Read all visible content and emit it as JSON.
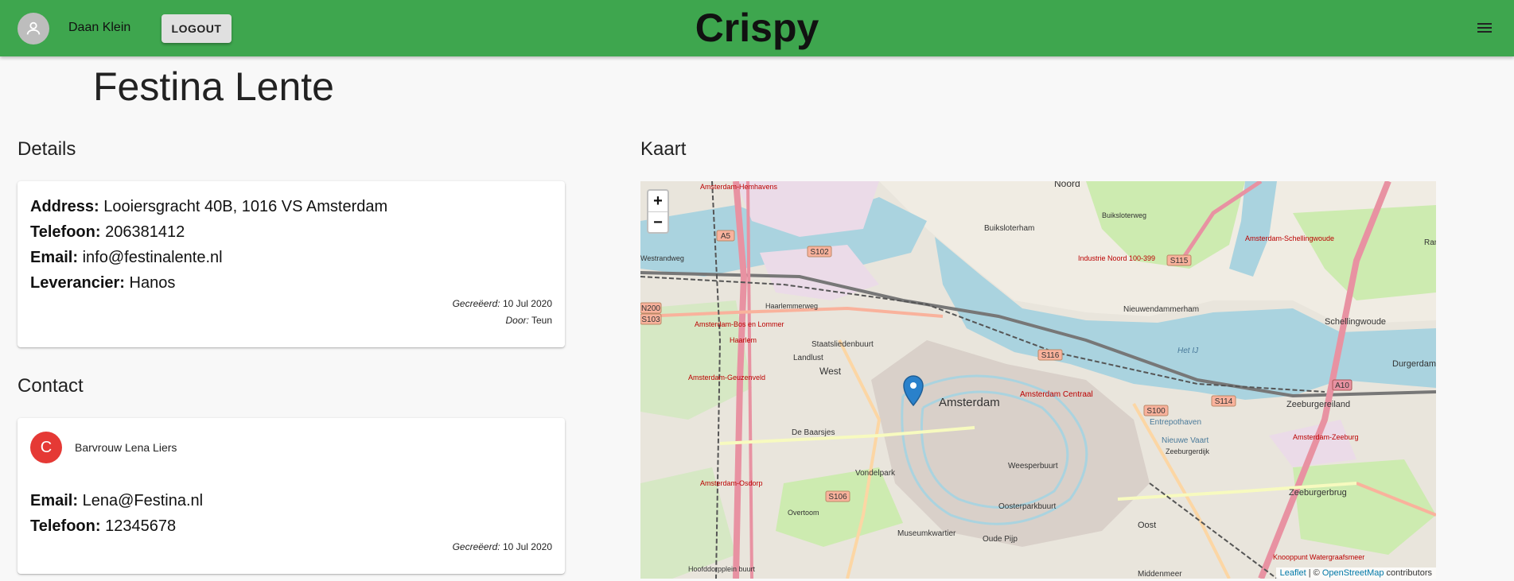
{
  "header": {
    "user_name": "Daan Klein",
    "logout_label": "LOGOUT",
    "brand": "Crispy",
    "icons": [
      "account-icon",
      "menu-icon"
    ]
  },
  "page": {
    "title": "Festina Lente"
  },
  "details": {
    "section_title": "Details",
    "fields": [
      {
        "label": "Address:",
        "value": "Looiersgracht 40B, 1016 VS Amsterdam"
      },
      {
        "label": "Telefoon:",
        "value": "206381412"
      },
      {
        "label": "Email:",
        "value": "info@festinalente.nl"
      },
      {
        "label": "Leverancier:",
        "value": "Hanos"
      }
    ],
    "created_label": "Gecreëerd:",
    "created_value": "10 Jul 2020",
    "by_label": "Door:",
    "by_value": "Teun"
  },
  "contact": {
    "section_title": "Contact",
    "avatar_letter": "C",
    "name": "Barvrouw Lena Liers",
    "fields": [
      {
        "label": "Email:",
        "value": "Lena@Festina.nl"
      },
      {
        "label": "Telefoon:",
        "value": "12345678"
      }
    ],
    "created_label": "Gecreëerd:",
    "created_value": "10 Jul 2020"
  },
  "map": {
    "section_title": "Kaart",
    "zoom_in": "+",
    "zoom_out": "−",
    "attribution": {
      "leaflet": "Leaflet",
      "separator": " | © ",
      "osm": "OpenStreetMap",
      "suffix": " contributors"
    },
    "labels": [
      "Noord",
      "Amsterdam",
      "West",
      "Oost",
      "Schellingwoude",
      "Durgerdam",
      "Zeeburgerbrug",
      "Zeeburgereiland",
      "Nieuwendammerham",
      "Het IJ",
      "Amsterdam Centraal",
      "Buiksloterham",
      "Staatsliedenbuurt",
      "Landlust",
      "Haarlemmerweg",
      "A5",
      "A10",
      "S102",
      "S103",
      "S106",
      "S114",
      "S115",
      "S116",
      "S100",
      "N200",
      "Amsterdam-Geuzenveld",
      "Amsterdam-Osdorp",
      "Vondelpark",
      "Oosterparkbuurt",
      "Middenmeer",
      "Westrandweg",
      "Amsterdam-Hemhavens",
      "Buiksloterweg",
      "Industrie Noord 100-399",
      "Amsterdam-Schellingwoude",
      "Amsterdam-Zeeburg",
      "Knooppunt Watergraafsmeer",
      "Rans",
      "Hoofddorpplein buurt",
      "Museumkwartier",
      "Oude Pijp",
      "Weesperbuurt",
      "Entrepothaven",
      "Nieuwe Vaart",
      "Zeeburgerdijk",
      "De Baarsjes",
      "Overtoom",
      "Amsterdam-Bos en Lommer",
      "Haarlem"
    ]
  }
}
